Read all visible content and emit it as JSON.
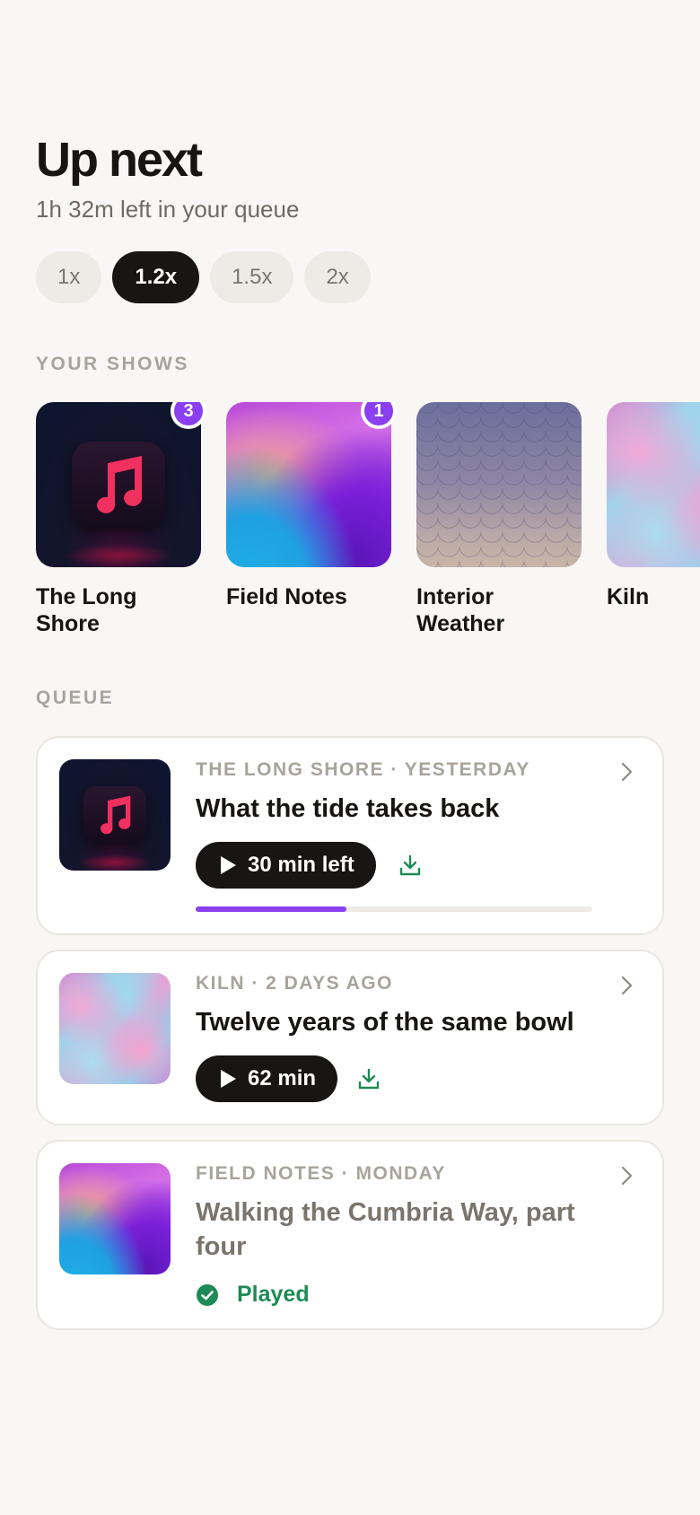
{
  "header": {
    "title": "Up next",
    "subtitle": "1h 32m left in your queue"
  },
  "speeds": {
    "options": [
      "1x",
      "1.2x",
      "1.5x",
      "2x"
    ],
    "selected": "1.2x"
  },
  "shows_section": {
    "label": "YOUR SHOWS",
    "items": [
      {
        "name": "The Long Shore",
        "badge": "3",
        "art": "music-note-icon"
      },
      {
        "name": "Field Notes",
        "badge": "1",
        "art": "purple-wave"
      },
      {
        "name": "Interior Weather",
        "badge": null,
        "art": "scale-pattern"
      },
      {
        "name": "Kiln",
        "badge": null,
        "art": "pink-blue-marble"
      }
    ]
  },
  "queue_section": {
    "label": "QUEUE",
    "items": [
      {
        "meta": "THE LONG SHORE · YESTERDAY",
        "title": "What the tide takes back",
        "play_label": "30 min left",
        "progress": 0.38,
        "art": "music-note-icon"
      },
      {
        "meta": "KILN · 2 DAYS AGO",
        "title": "Twelve years of the same bowl",
        "play_label": "62 min",
        "art": "pink-blue-marble"
      },
      {
        "meta": "FIELD NOTES · MONDAY",
        "title": "Walking the Cumbria Way, part four",
        "status": "Played",
        "art": "purple-wave"
      }
    ]
  },
  "colors": {
    "accent": "#8a3ff0",
    "played_green": "#1e8a55",
    "dark": "#181614",
    "background": "#f8f7f5"
  }
}
